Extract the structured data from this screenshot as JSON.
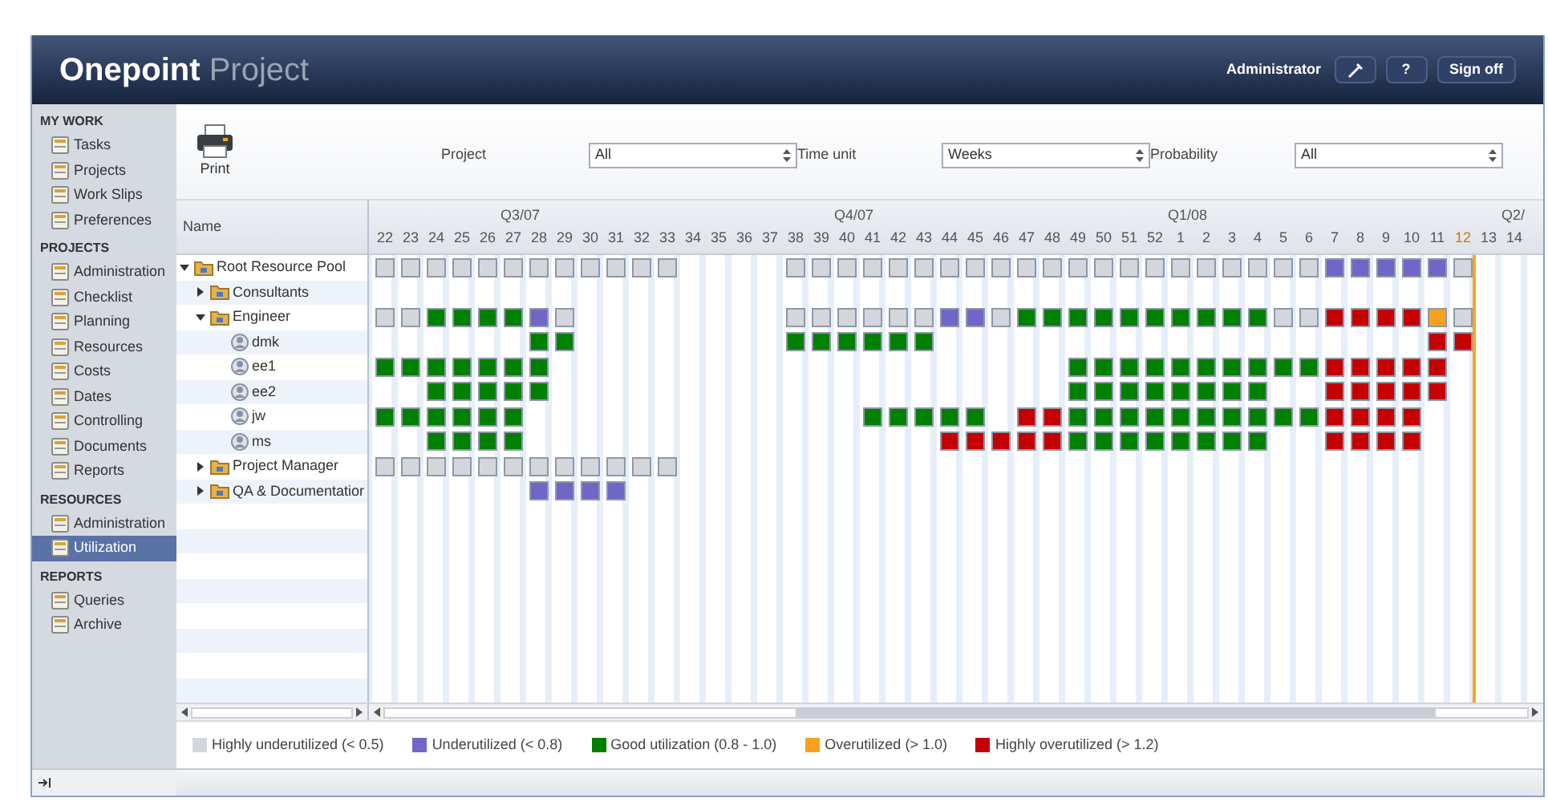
{
  "app_title": {
    "brand": "Onepoint",
    "product": "Project"
  },
  "header": {
    "user": "Administrator",
    "help_button": "?",
    "sign_off_button": "Sign off"
  },
  "sidebar": {
    "sections": [
      {
        "title": "MY WORK",
        "items": [
          {
            "label": "Tasks",
            "selected": false
          },
          {
            "label": "Projects",
            "selected": false
          },
          {
            "label": "Work Slips",
            "selected": false
          },
          {
            "label": "Preferences",
            "selected": false
          }
        ]
      },
      {
        "title": "PROJECTS",
        "items": [
          {
            "label": "Administration",
            "selected": false
          },
          {
            "label": "Checklist",
            "selected": false
          },
          {
            "label": "Planning",
            "selected": false
          },
          {
            "label": "Resources",
            "selected": false
          },
          {
            "label": "Costs",
            "selected": false
          },
          {
            "label": "Dates",
            "selected": false
          },
          {
            "label": "Controlling",
            "selected": false
          },
          {
            "label": "Documents",
            "selected": false
          },
          {
            "label": "Reports",
            "selected": false
          }
        ]
      },
      {
        "title": "RESOURCES",
        "items": [
          {
            "label": "Administration",
            "selected": false
          },
          {
            "label": "Utilization",
            "selected": true
          }
        ]
      },
      {
        "title": "REPORTS",
        "items": [
          {
            "label": "Queries",
            "selected": false
          },
          {
            "label": "Archive",
            "selected": false
          }
        ]
      }
    ]
  },
  "toolbar": {
    "print_button": "Print",
    "filters": [
      {
        "label": "Project",
        "value": "All"
      },
      {
        "label": "Time unit",
        "value": "Weeks"
      },
      {
        "label": "Probability",
        "value": "All"
      }
    ]
  },
  "name_column": "Name",
  "weeks": [
    {
      "label": "22",
      "current": false
    },
    {
      "label": "23",
      "current": false
    },
    {
      "label": "24",
      "current": false
    },
    {
      "label": "25",
      "current": false
    },
    {
      "label": "26",
      "current": false
    },
    {
      "label": "27",
      "current": false,
      "quarter": "Q3/07"
    },
    {
      "label": "28",
      "current": false
    },
    {
      "label": "29",
      "current": false
    },
    {
      "label": "30",
      "current": false
    },
    {
      "label": "31",
      "current": false
    },
    {
      "label": "32",
      "current": false
    },
    {
      "label": "33",
      "current": false
    },
    {
      "label": "34",
      "current": false
    },
    {
      "label": "35",
      "current": false
    },
    {
      "label": "36",
      "current": false
    },
    {
      "label": "37",
      "current": false
    },
    {
      "label": "38",
      "current": false
    },
    {
      "label": "39",
      "current": false
    },
    {
      "label": "40",
      "current": false,
      "quarter": "Q4/07"
    },
    {
      "label": "41",
      "current": false
    },
    {
      "label": "42",
      "current": false
    },
    {
      "label": "43",
      "current": false
    },
    {
      "label": "44",
      "current": false
    },
    {
      "label": "45",
      "current": false
    },
    {
      "label": "46",
      "current": false
    },
    {
      "label": "47",
      "current": false
    },
    {
      "label": "48",
      "current": false
    },
    {
      "label": "49",
      "current": false
    },
    {
      "label": "50",
      "current": false
    },
    {
      "label": "51",
      "current": false
    },
    {
      "label": "52",
      "current": false
    },
    {
      "label": "1",
      "current": false,
      "quarter": "Q1/08"
    },
    {
      "label": "2",
      "current": false
    },
    {
      "label": "3",
      "current": false
    },
    {
      "label": "4",
      "current": false
    },
    {
      "label": "5",
      "current": false
    },
    {
      "label": "6",
      "current": false
    },
    {
      "label": "7",
      "current": false
    },
    {
      "label": "8",
      "current": false
    },
    {
      "label": "9",
      "current": false
    },
    {
      "label": "10",
      "current": false
    },
    {
      "label": "11",
      "current": false
    },
    {
      "label": "12",
      "current": true
    },
    {
      "label": "13",
      "current": false
    },
    {
      "label": "14",
      "current": false,
      "quarter": "Q2/"
    }
  ],
  "resources": [
    {
      "name": "Root Resource Pool",
      "kind": "pool",
      "expanded": true,
      "cells": [
        {
          "kind": "low"
        },
        {
          "kind": "low"
        },
        {
          "kind": "low"
        },
        {
          "kind": "low"
        },
        {
          "kind": "low"
        },
        {
          "kind": "low"
        },
        {
          "kind": "low"
        },
        {
          "kind": "low"
        },
        {
          "kind": "low"
        },
        {
          "kind": "low"
        },
        {
          "kind": "low"
        },
        {
          "kind": "low"
        },
        {
          "kind": "empty"
        },
        {
          "kind": "empty"
        },
        {
          "kind": "empty"
        },
        {
          "kind": "empty"
        },
        {
          "kind": "low"
        },
        {
          "kind": "low"
        },
        {
          "kind": "low"
        },
        {
          "kind": "low"
        },
        {
          "kind": "low"
        },
        {
          "kind": "low"
        },
        {
          "kind": "low"
        },
        {
          "kind": "low"
        },
        {
          "kind": "low"
        },
        {
          "kind": "low"
        },
        {
          "kind": "low"
        },
        {
          "kind": "low"
        },
        {
          "kind": "low"
        },
        {
          "kind": "low"
        },
        {
          "kind": "low"
        },
        {
          "kind": "low"
        },
        {
          "kind": "low"
        },
        {
          "kind": "low"
        },
        {
          "kind": "low"
        },
        {
          "kind": "low"
        },
        {
          "kind": "low"
        },
        {
          "kind": "under"
        },
        {
          "kind": "under"
        },
        {
          "kind": "under"
        },
        {
          "kind": "under"
        },
        {
          "kind": "under"
        },
        {
          "kind": "low"
        }
      ],
      "children": [
        {
          "name": "Consultants",
          "kind": "pool",
          "expanded": false
        },
        {
          "name": "Engineer",
          "kind": "pool",
          "expanded": true,
          "cells": [
            {
              "kind": "low"
            },
            {
              "kind": "low"
            },
            {
              "kind": "good"
            },
            {
              "kind": "good"
            },
            {
              "kind": "good"
            },
            {
              "kind": "good"
            },
            {
              "kind": "under"
            },
            {
              "kind": "low"
            },
            {
              "kind": "empty"
            },
            {
              "kind": "empty"
            },
            {
              "kind": "empty"
            },
            {
              "kind": "empty"
            },
            {
              "kind": "empty"
            },
            {
              "kind": "empty"
            },
            {
              "kind": "empty"
            },
            {
              "kind": "empty"
            },
            {
              "kind": "low"
            },
            {
              "kind": "low"
            },
            {
              "kind": "low"
            },
            {
              "kind": "low"
            },
            {
              "kind": "low"
            },
            {
              "kind": "low"
            },
            {
              "kind": "under"
            },
            {
              "kind": "under"
            },
            {
              "kind": "low"
            },
            {
              "kind": "good"
            },
            {
              "kind": "good"
            },
            {
              "kind": "good"
            },
            {
              "kind": "good"
            },
            {
              "kind": "good"
            },
            {
              "kind": "good"
            },
            {
              "kind": "good"
            },
            {
              "kind": "good"
            },
            {
              "kind": "good"
            },
            {
              "kind": "good"
            },
            {
              "kind": "low"
            },
            {
              "kind": "low"
            },
            {
              "kind": "high"
            },
            {
              "kind": "high"
            },
            {
              "kind": "high"
            },
            {
              "kind": "high"
            },
            {
              "kind": "over"
            },
            {
              "kind": "low"
            }
          ],
          "children": [
            {
              "name": "dmk",
              "kind": "resource",
              "cells": [
                {
                  "kind": "empty"
                },
                {
                  "kind": "empty"
                },
                {
                  "kind": "empty"
                },
                {
                  "kind": "empty"
                },
                {
                  "kind": "empty"
                },
                {
                  "kind": "empty"
                },
                {
                  "kind": "good"
                },
                {
                  "kind": "good"
                },
                {
                  "kind": "empty"
                },
                {
                  "kind": "empty"
                },
                {
                  "kind": "empty"
                },
                {
                  "kind": "empty"
                },
                {
                  "kind": "empty"
                },
                {
                  "kind": "empty"
                },
                {
                  "kind": "empty"
                },
                {
                  "kind": "empty"
                },
                {
                  "kind": "good"
                },
                {
                  "kind": "good"
                },
                {
                  "kind": "good"
                },
                {
                  "kind": "good"
                },
                {
                  "kind": "good"
                },
                {
                  "kind": "good"
                },
                {
                  "kind": "empty"
                },
                {
                  "kind": "empty"
                },
                {
                  "kind": "empty"
                },
                {
                  "kind": "empty"
                },
                {
                  "kind": "empty"
                },
                {
                  "kind": "empty"
                },
                {
                  "kind": "empty"
                },
                {
                  "kind": "empty"
                },
                {
                  "kind": "empty"
                },
                {
                  "kind": "empty"
                },
                {
                  "kind": "empty"
                },
                {
                  "kind": "empty"
                },
                {
                  "kind": "empty"
                },
                {
                  "kind": "empty"
                },
                {
                  "kind": "empty"
                },
                {
                  "kind": "empty"
                },
                {
                  "kind": "empty"
                },
                {
                  "kind": "empty"
                },
                {
                  "kind": "empty"
                },
                {
                  "kind": "high"
                },
                {
                  "kind": "high"
                }
              ]
            },
            {
              "name": "ee1",
              "kind": "resource",
              "cells": [
                {
                  "kind": "good"
                },
                {
                  "kind": "good"
                },
                {
                  "kind": "good"
                },
                {
                  "kind": "good"
                },
                {
                  "kind": "good"
                },
                {
                  "kind": "good"
                },
                {
                  "kind": "good"
                },
                {
                  "kind": "empty"
                },
                {
                  "kind": "empty"
                },
                {
                  "kind": "empty"
                },
                {
                  "kind": "empty"
                },
                {
                  "kind": "empty"
                },
                {
                  "kind": "empty"
                },
                {
                  "kind": "empty"
                },
                {
                  "kind": "empty"
                },
                {
                  "kind": "empty"
                },
                {
                  "kind": "empty"
                },
                {
                  "kind": "empty"
                },
                {
                  "kind": "empty"
                },
                {
                  "kind": "empty"
                },
                {
                  "kind": "empty"
                },
                {
                  "kind": "empty"
                },
                {
                  "kind": "empty"
                },
                {
                  "kind": "empty"
                },
                {
                  "kind": "empty"
                },
                {
                  "kind": "empty"
                },
                {
                  "kind": "empty"
                },
                {
                  "kind": "good"
                },
                {
                  "kind": "good"
                },
                {
                  "kind": "good"
                },
                {
                  "kind": "good"
                },
                {
                  "kind": "good"
                },
                {
                  "kind": "good"
                },
                {
                  "kind": "good"
                },
                {
                  "kind": "good"
                },
                {
                  "kind": "good"
                },
                {
                  "kind": "good"
                },
                {
                  "kind": "high"
                },
                {
                  "kind": "high"
                },
                {
                  "kind": "high"
                },
                {
                  "kind": "high"
                },
                {
                  "kind": "high"
                }
              ]
            },
            {
              "name": "ee2",
              "kind": "resource",
              "cells": [
                {
                  "kind": "empty"
                },
                {
                  "kind": "empty"
                },
                {
                  "kind": "good"
                },
                {
                  "kind": "good"
                },
                {
                  "kind": "good"
                },
                {
                  "kind": "good"
                },
                {
                  "kind": "good"
                },
                {
                  "kind": "empty"
                },
                {
                  "kind": "empty"
                },
                {
                  "kind": "empty"
                },
                {
                  "kind": "empty"
                },
                {
                  "kind": "empty"
                },
                {
                  "kind": "empty"
                },
                {
                  "kind": "empty"
                },
                {
                  "kind": "empty"
                },
                {
                  "kind": "empty"
                },
                {
                  "kind": "empty"
                },
                {
                  "kind": "empty"
                },
                {
                  "kind": "empty"
                },
                {
                  "kind": "empty"
                },
                {
                  "kind": "empty"
                },
                {
                  "kind": "empty"
                },
                {
                  "kind": "empty"
                },
                {
                  "kind": "empty"
                },
                {
                  "kind": "empty"
                },
                {
                  "kind": "empty"
                },
                {
                  "kind": "empty"
                },
                {
                  "kind": "good"
                },
                {
                  "kind": "good"
                },
                {
                  "kind": "good"
                },
                {
                  "kind": "good"
                },
                {
                  "kind": "good"
                },
                {
                  "kind": "good"
                },
                {
                  "kind": "good"
                },
                {
                  "kind": "good"
                },
                {
                  "kind": "empty"
                },
                {
                  "kind": "empty"
                },
                {
                  "kind": "high"
                },
                {
                  "kind": "high"
                },
                {
                  "kind": "high"
                },
                {
                  "kind": "high"
                },
                {
                  "kind": "high"
                }
              ]
            },
            {
              "name": "jw",
              "kind": "resource",
              "cells": [
                {
                  "kind": "good"
                },
                {
                  "kind": "good"
                },
                {
                  "kind": "good"
                },
                {
                  "kind": "good"
                },
                {
                  "kind": "good"
                },
                {
                  "kind": "good"
                },
                {
                  "kind": "empty"
                },
                {
                  "kind": "empty"
                },
                {
                  "kind": "empty"
                },
                {
                  "kind": "empty"
                },
                {
                  "kind": "empty"
                },
                {
                  "kind": "empty"
                },
                {
                  "kind": "empty"
                },
                {
                  "kind": "empty"
                },
                {
                  "kind": "empty"
                },
                {
                  "kind": "empty"
                },
                {
                  "kind": "empty"
                },
                {
                  "kind": "empty"
                },
                {
                  "kind": "empty"
                },
                {
                  "kind": "good"
                },
                {
                  "kind": "good"
                },
                {
                  "kind": "good"
                },
                {
                  "kind": "good"
                },
                {
                  "kind": "good"
                },
                {
                  "kind": "empty"
                },
                {
                  "kind": "high"
                },
                {
                  "kind": "high"
                },
                {
                  "kind": "good"
                },
                {
                  "kind": "good"
                },
                {
                  "kind": "good"
                },
                {
                  "kind": "good"
                },
                {
                  "kind": "good"
                },
                {
                  "kind": "good"
                },
                {
                  "kind": "good"
                },
                {
                  "kind": "good"
                },
                {
                  "kind": "good"
                },
                {
                  "kind": "good"
                },
                {
                  "kind": "high"
                },
                {
                  "kind": "high"
                },
                {
                  "kind": "high"
                },
                {
                  "kind": "high"
                }
              ]
            },
            {
              "name": "ms",
              "kind": "resource",
              "cells": [
                {
                  "kind": "empty"
                },
                {
                  "kind": "empty"
                },
                {
                  "kind": "good"
                },
                {
                  "kind": "good"
                },
                {
                  "kind": "good"
                },
                {
                  "kind": "good"
                },
                {
                  "kind": "empty"
                },
                {
                  "kind": "empty"
                },
                {
                  "kind": "empty"
                },
                {
                  "kind": "empty"
                },
                {
                  "kind": "empty"
                },
                {
                  "kind": "empty"
                },
                {
                  "kind": "empty"
                },
                {
                  "kind": "empty"
                },
                {
                  "kind": "empty"
                },
                {
                  "kind": "empty"
                },
                {
                  "kind": "empty"
                },
                {
                  "kind": "empty"
                },
                {
                  "kind": "empty"
                },
                {
                  "kind": "empty"
                },
                {
                  "kind": "empty"
                },
                {
                  "kind": "empty"
                },
                {
                  "kind": "high"
                },
                {
                  "kind": "high"
                },
                {
                  "kind": "high"
                },
                {
                  "kind": "high"
                },
                {
                  "kind": "high"
                },
                {
                  "kind": "good"
                },
                {
                  "kind": "good"
                },
                {
                  "kind": "good"
                },
                {
                  "kind": "good"
                },
                {
                  "kind": "good"
                },
                {
                  "kind": "good"
                },
                {
                  "kind": "good"
                },
                {
                  "kind": "good"
                },
                {
                  "kind": "empty"
                },
                {
                  "kind": "empty"
                },
                {
                  "kind": "high"
                },
                {
                  "kind": "high"
                },
                {
                  "kind": "high"
                },
                {
                  "kind": "high"
                }
              ]
            }
          ]
        },
        {
          "name": "Project Manager",
          "kind": "pool",
          "expanded": false,
          "cells": [
            {
              "kind": "low"
            },
            {
              "kind": "low"
            },
            {
              "kind": "low"
            },
            {
              "kind": "low"
            },
            {
              "kind": "low"
            },
            {
              "kind": "low"
            },
            {
              "kind": "low"
            },
            {
              "kind": "low"
            },
            {
              "kind": "low"
            },
            {
              "kind": "low"
            },
            {
              "kind": "low"
            },
            {
              "kind": "low"
            }
          ]
        },
        {
          "name": "QA & Documentatior",
          "kind": "pool",
          "expanded": false,
          "cells": [
            {
              "kind": "empty"
            },
            {
              "kind": "empty"
            },
            {
              "kind": "empty"
            },
            {
              "kind": "empty"
            },
            {
              "kind": "empty"
            },
            {
              "kind": "empty"
            },
            {
              "kind": "under"
            },
            {
              "kind": "under"
            },
            {
              "kind": "under"
            },
            {
              "kind": "under"
            }
          ]
        }
      ]
    }
  ],
  "legend": [
    {
      "kind": "low",
      "label": "Highly underutilized (< 0.5)",
      "color": "#d3d6dd"
    },
    {
      "kind": "under",
      "label": "Underutilized (< 0.8)",
      "color": "#7066c8"
    },
    {
      "kind": "good",
      "label": "Good utilization (0.8 - 1.0)",
      "color": "#008000"
    },
    {
      "kind": "over",
      "label": "Overutilized (> 1.0)",
      "color": "#f6a21e"
    },
    {
      "kind": "high",
      "label": "Highly overutilized (> 1.2)",
      "color": "#c40000"
    }
  ]
}
